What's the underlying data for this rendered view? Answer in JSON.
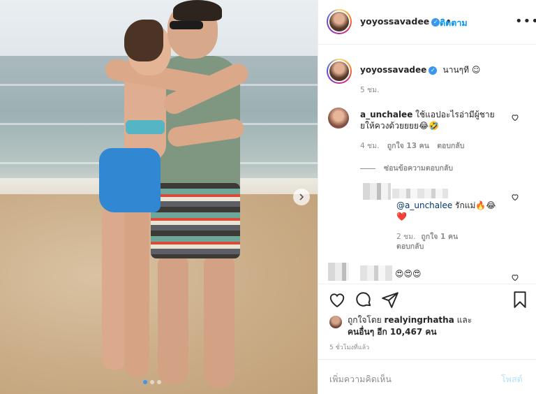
{
  "header": {
    "username": "yoyossavadee",
    "separator": "•",
    "follow_label": "ติดตาม",
    "more_label": "•••"
  },
  "caption": {
    "username": "yoyossavadee",
    "text": "นานๆที ☺",
    "time": "5 ชม."
  },
  "comments": [
    {
      "username": "a_unchalee",
      "text_line1": "ใช้แอปอะไรอ่ามีผู้ชาย",
      "text_line2": "ยให้ควงด้วยยยย😂🤣",
      "time": "4 ชม.",
      "likes": "ถูกใจ 13 คน",
      "reply": "ตอบกลับ"
    }
  ],
  "hide_replies": "ซ่อนข้อความตอบกลับ",
  "reply": {
    "mention": "@a_unchalee",
    "text": " รักแม่🔥😂",
    "heart": "❤️",
    "time": "2 ชม.",
    "likes": "ถูกใจ 1 คน",
    "reply": "ตอบกลับ"
  },
  "comment3": {
    "text": "😍😍😍"
  },
  "likes": {
    "prefix": "ถูกใจโดย ",
    "by": "realyingrhatha",
    "and": " และ",
    "others": "คนอื่นๆ อีก 10,467 คน"
  },
  "timestamp": "5 ชั่วโมงที่แล้ว",
  "add_comment": {
    "placeholder": "เพิ่มความคิดเห็น",
    "post_label": "โพสต์"
  },
  "colors": {
    "link": "#0095f6",
    "verified": "#3897f0",
    "heart_red": "#ed4956"
  }
}
